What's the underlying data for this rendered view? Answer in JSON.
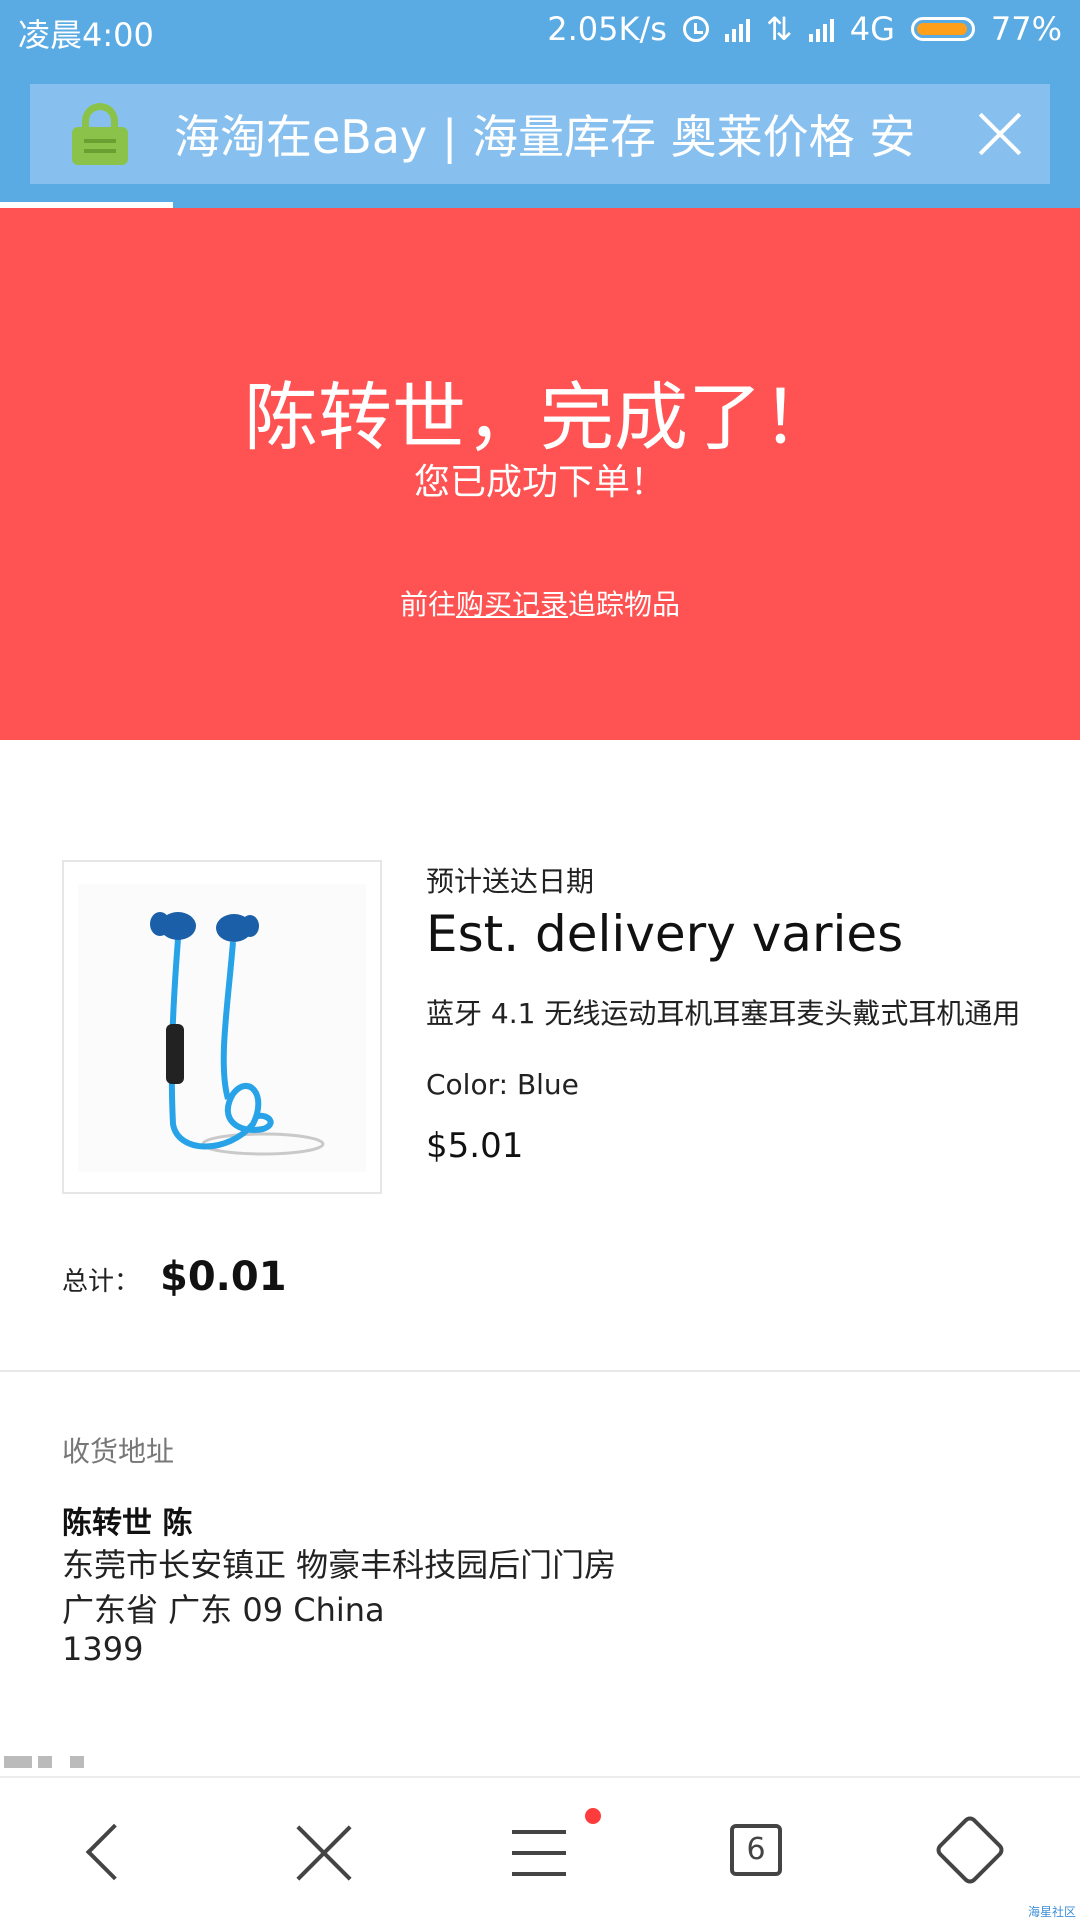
{
  "status_bar": {
    "time": "凌晨4:00",
    "net_speed": "2.05K/s",
    "network": "4G",
    "battery": "77%",
    "icons": [
      "alarm-icon",
      "signal-icon",
      "data-arrows-icon",
      "signal-icon",
      "battery-icon"
    ]
  },
  "browser": {
    "page_title": "海淘在eBay | 海量库存 奥莱价格 安",
    "load_progress": 0.16,
    "accent": "#5aaae3"
  },
  "hero": {
    "title": "陈转世，完成了！",
    "subtitle": "您已成功下单！",
    "track_prefix": "前往",
    "track_link": "购买记录",
    "track_suffix": "追踪物品",
    "background": "#ff5252"
  },
  "order": {
    "delivery_label": "预计送达日期",
    "delivery_value": "Est. delivery varies",
    "item_title": "蓝牙 4.1 无线运动耳机耳塞耳麦头戴式耳机通用",
    "item_color": "Color: Blue",
    "item_price": "$5.01",
    "total_label": "总计：",
    "total_value": "$0.01"
  },
  "address": {
    "heading": "收货地址",
    "name": "陈转世 陈",
    "line1": "东莞市长安镇正 物豪丰科技园后门门房",
    "line2": "广东省 广东 09 China",
    "line3": "1399"
  },
  "nav": {
    "tab_count": "6"
  },
  "watermark": "海星社区"
}
